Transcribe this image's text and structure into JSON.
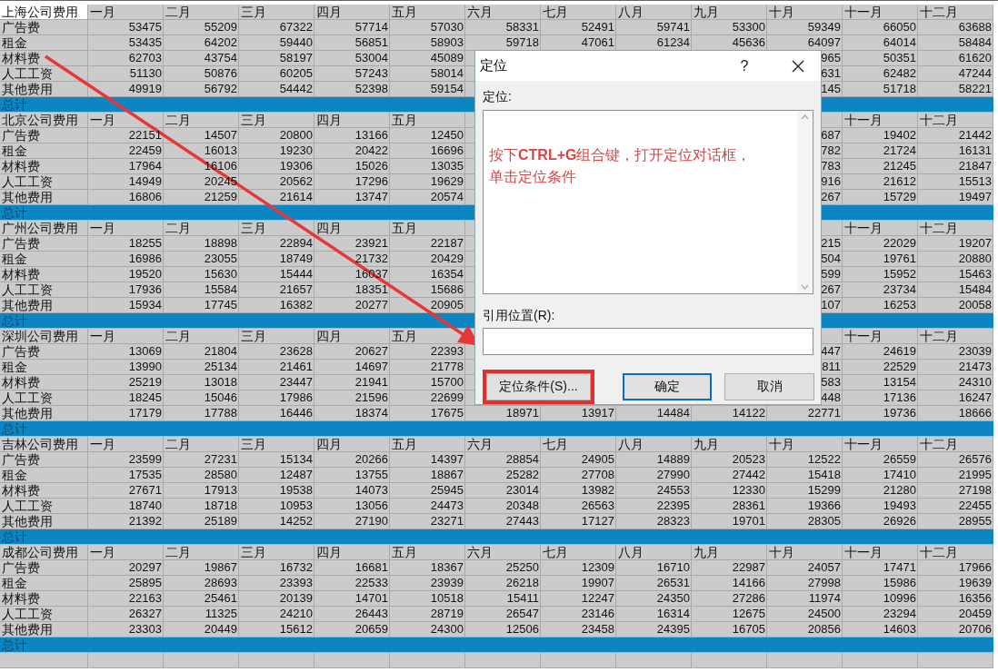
{
  "sheet": {
    "blocks": [
      {
        "label_active": true,
        "header": [
          "上海公司费用",
          "一月",
          "二月",
          "三月",
          "四月",
          "五月",
          "六月",
          "七月",
          "八月",
          "九月",
          "十月",
          "十一月",
          "十二月"
        ],
        "rows": [
          {
            "cells": [
              "广告费",
              "53475",
              "55209",
              "67322",
              "57714",
              "57030",
              "58331",
              "52491",
              "59741",
              "53300",
              "59349",
              "66050",
              "63688"
            ]
          },
          {
            "cells": [
              "租金",
              "53435",
              "64202",
              "59440",
              "56851",
              "58903",
              "59718",
              "47061",
              "61234",
              "45636",
              "64097",
              "64014",
              "58484"
            ]
          },
          {
            "cells": [
              "材料费",
              "62703",
              "43754",
              "58197",
              "53004",
              "45089"
            ],
            "right_cells": [
              "965",
              "50351",
              "61620"
            ]
          },
          {
            "cells": [
              "人工工资",
              "51130",
              "50876",
              "60205",
              "57243",
              "58014"
            ],
            "right_cells": [
              "631",
              "62482",
              "47244"
            ]
          },
          {
            "cells": [
              "其他费用",
              "49919",
              "56792",
              "54442",
              "52398",
              "59154"
            ],
            "right_cells": [
              "145",
              "51718",
              "58221"
            ]
          }
        ],
        "total": "总计"
      },
      {
        "label_active": false,
        "header": [
          "北京公司费用",
          "一月",
          "二月",
          "三月",
          "四月",
          "五月"
        ],
        "header_right": [
          "十一月",
          "十二月"
        ],
        "rows": [
          {
            "cells": [
              "广告费",
              "22151",
              "14507",
              "20800",
              "13166",
              "12450"
            ],
            "right_cells": [
              "687",
              "19402",
              "21442"
            ]
          },
          {
            "cells": [
              "租金",
              "22459",
              "16013",
              "19230",
              "20422",
              "16696"
            ],
            "right_cells": [
              "782",
              "21724",
              "16131"
            ]
          },
          {
            "cells": [
              "材料费",
              "17964",
              "16106",
              "19306",
              "15026",
              "13035"
            ],
            "right_cells": [
              "783",
              "21245",
              "21847"
            ]
          },
          {
            "cells": [
              "人工工资",
              "14949",
              "20245",
              "20562",
              "17296",
              "19629"
            ],
            "right_cells": [
              "916",
              "21612",
              "15513"
            ]
          },
          {
            "cells": [
              "其他费用",
              "16806",
              "21259",
              "21614",
              "13747",
              "20574"
            ],
            "right_cells": [
              "267",
              "15729",
              "19497"
            ]
          }
        ],
        "total": "总计"
      },
      {
        "label_active": false,
        "header": [
          "广州公司费用",
          "一月",
          "二月",
          "三月",
          "四月",
          "五月"
        ],
        "header_right": [
          "十一月",
          "十二月"
        ],
        "rows": [
          {
            "cells": [
              "广告费",
              "18255",
              "18898",
              "22894",
              "23921",
              "22187"
            ],
            "right_cells": [
              "215",
              "22029",
              "19207"
            ]
          },
          {
            "cells": [
              "租金",
              "16986",
              "23055",
              "18749",
              "21732",
              "20429"
            ],
            "right_cells": [
              "504",
              "19761",
              "20880"
            ]
          },
          {
            "cells": [
              "材料费",
              "19520",
              "15630",
              "15444",
              "16037",
              "16354"
            ],
            "right_cells": [
              "599",
              "15952",
              "15463"
            ]
          },
          {
            "cells": [
              "人工工资",
              "17936",
              "15584",
              "21657",
              "18351",
              "15686"
            ],
            "right_cells": [
              "267",
              "23734",
              "15484"
            ]
          },
          {
            "cells": [
              "其他费用",
              "15934",
              "17745",
              "16382",
              "20277",
              "20905"
            ],
            "right_cells": [
              "107",
              "16253",
              "20058"
            ]
          }
        ],
        "total": "总计"
      },
      {
        "label_active": false,
        "header": [
          "深圳公司费用",
          "一月",
          "二月",
          "三月",
          "四月",
          "五月"
        ],
        "header_right": [
          "十一月",
          "十二月"
        ],
        "rows": [
          {
            "cells": [
              "广告费",
              "13069",
              "21804",
              "23628",
              "20627",
              "22393"
            ],
            "right_cells": [
              "447",
              "24619",
              "23039"
            ]
          },
          {
            "cells": [
              "租金",
              "13990",
              "25134",
              "21461",
              "14697",
              "21778"
            ],
            "right_cells": [
              "811",
              "22529",
              "21473"
            ]
          },
          {
            "cells": [
              "材料费",
              "25219",
              "13018",
              "23447",
              "21941",
              "15700"
            ],
            "right_cells": [
              "583",
              "13154",
              "24310"
            ]
          },
          {
            "cells": [
              "人工工资",
              "18245",
              "15046",
              "17986",
              "21596",
              "22699"
            ],
            "right_cells": [
              "448",
              "17136",
              "16247"
            ]
          },
          {
            "cells": [
              "其他费用",
              "17179",
              "17788",
              "16446",
              "18374",
              "17675",
              "18971",
              "13917",
              "14484",
              "14122",
              "22771",
              "19736",
              "18666"
            ]
          }
        ],
        "total": "总计"
      },
      {
        "label_active": false,
        "header": [
          "吉林公司费用",
          "一月",
          "二月",
          "三月",
          "四月",
          "五月",
          "六月",
          "七月",
          "八月",
          "九月",
          "十月",
          "十一月",
          "十二月"
        ],
        "rows": [
          {
            "cells": [
              "广告费",
              "23599",
              "27231",
              "15134",
              "20266",
              "14397",
              "28854",
              "24905",
              "14889",
              "20523",
              "12522",
              "26559",
              "26576"
            ]
          },
          {
            "cells": [
              "租金",
              "17535",
              "28580",
              "12487",
              "13755",
              "18867",
              "25282",
              "27708",
              "27990",
              "27442",
              "15418",
              "17410",
              "21995"
            ]
          },
          {
            "cells": [
              "材料费",
              "27671",
              "17913",
              "19538",
              "14073",
              "25945",
              "23014",
              "13982",
              "24553",
              "12330",
              "15299",
              "21280",
              "27198"
            ]
          },
          {
            "cells": [
              "人工工资",
              "18740",
              "18718",
              "10953",
              "13056",
              "24473",
              "20348",
              "26563",
              "22395",
              "28361",
              "19366",
              "19493",
              "22455"
            ]
          },
          {
            "cells": [
              "其他费用",
              "21392",
              "25189",
              "14252",
              "27190",
              "23271",
              "27443",
              "17127",
              "28323",
              "19701",
              "28305",
              "26926",
              "28955"
            ]
          }
        ],
        "total": "总计"
      },
      {
        "label_active": false,
        "header": [
          "成都公司费用",
          "一月",
          "二月",
          "三月",
          "四月",
          "五月",
          "六月",
          "七月",
          "八月",
          "九月",
          "十月",
          "十一月",
          "十二月"
        ],
        "rows": [
          {
            "cells": [
              "广告费",
              "20297",
              "19867",
              "16732",
              "16681",
              "18367",
              "25250",
              "12309",
              "16710",
              "22987",
              "24057",
              "17471",
              "17966"
            ]
          },
          {
            "cells": [
              "租金",
              "25895",
              "28693",
              "23393",
              "22533",
              "23939",
              "26218",
              "19907",
              "26531",
              "14166",
              "27998",
              "15986",
              "19639"
            ]
          },
          {
            "cells": [
              "材料费",
              "22163",
              "25461",
              "20139",
              "14701",
              "10518",
              "15411",
              "12247",
              "24350",
              "27286",
              "11974",
              "10996",
              "16356"
            ]
          },
          {
            "cells": [
              "人工工资",
              "26327",
              "11325",
              "24210",
              "26443",
              "28719",
              "26547",
              "23146",
              "16314",
              "12675",
              "24500",
              "23294",
              "20459"
            ]
          },
          {
            "cells": [
              "其他费用",
              "23303",
              "20449",
              "15612",
              "20659",
              "24300",
              "12506",
              "23458",
              "24395",
              "16705",
              "20856",
              "14603",
              "20706"
            ]
          }
        ],
        "total": "总计"
      }
    ]
  },
  "dialog": {
    "title": "定位",
    "help": "?",
    "list_label": "定位:",
    "note": "按下**CTRL+G**组合键，打开定位对话框，单击定位条件",
    "reference_label": "引用位置(R):",
    "buttons": [
      {
        "label": "定位条件(S)...",
        "default": false,
        "highlighted": true
      },
      {
        "label": "确定",
        "default": true,
        "highlighted": false
      },
      {
        "label": "取消",
        "default": false,
        "highlighted": false
      }
    ]
  }
}
